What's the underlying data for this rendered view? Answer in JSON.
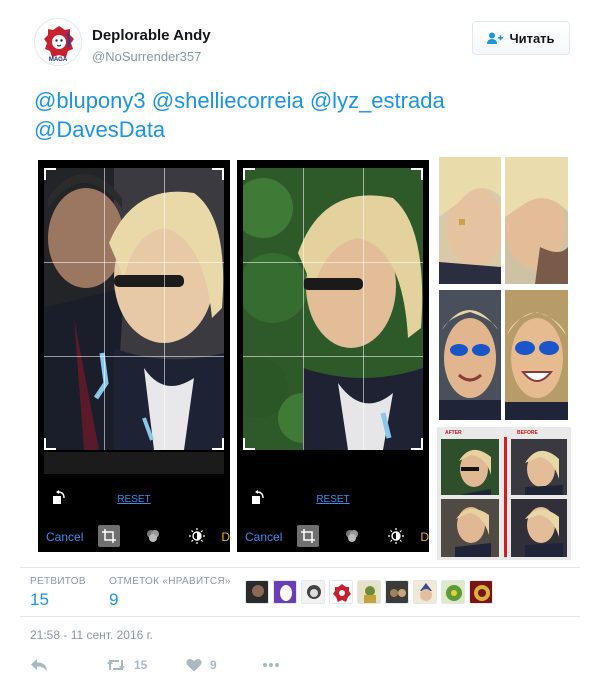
{
  "user": {
    "display_name": "Deplorable Andy",
    "handle": "@NoSurrender357",
    "avatar_badge": "MAGA"
  },
  "follow_button": {
    "label": "Читать",
    "icon": "add-user-icon"
  },
  "tweet": {
    "mentions": [
      "@blupony3",
      "@shelliecorreia",
      "@lyz_estrada",
      "@DavesData"
    ]
  },
  "editor_panels": [
    {
      "reset_label": "RESET",
      "cancel_label": "Cancel",
      "truncated_label": "D"
    },
    {
      "reset_label": "RESET",
      "cancel_label": "Cancel",
      "truncated_label": "D"
    }
  ],
  "collage": {
    "after_label": "AFTER",
    "before_label": "BEFORE"
  },
  "stats": {
    "retweets_label": "РЕТВИТОВ",
    "retweets_value": "15",
    "likes_label": "ОТМЕТОК «НРАВИТСЯ»",
    "likes_value": "9"
  },
  "timestamp": "21:58 - 11 сент. 2016 г.",
  "actions": {
    "reply_icon": "reply-icon",
    "retweet_icon": "retweet-icon",
    "retweet_count": "15",
    "like_icon": "heart-icon",
    "like_count": "9",
    "more_icon": "more-icon"
  },
  "colors": {
    "link": "#1b95e0",
    "muted": "#8899a6",
    "editor_link": "#3b8cf0",
    "divider": "#e1e8ed"
  }
}
